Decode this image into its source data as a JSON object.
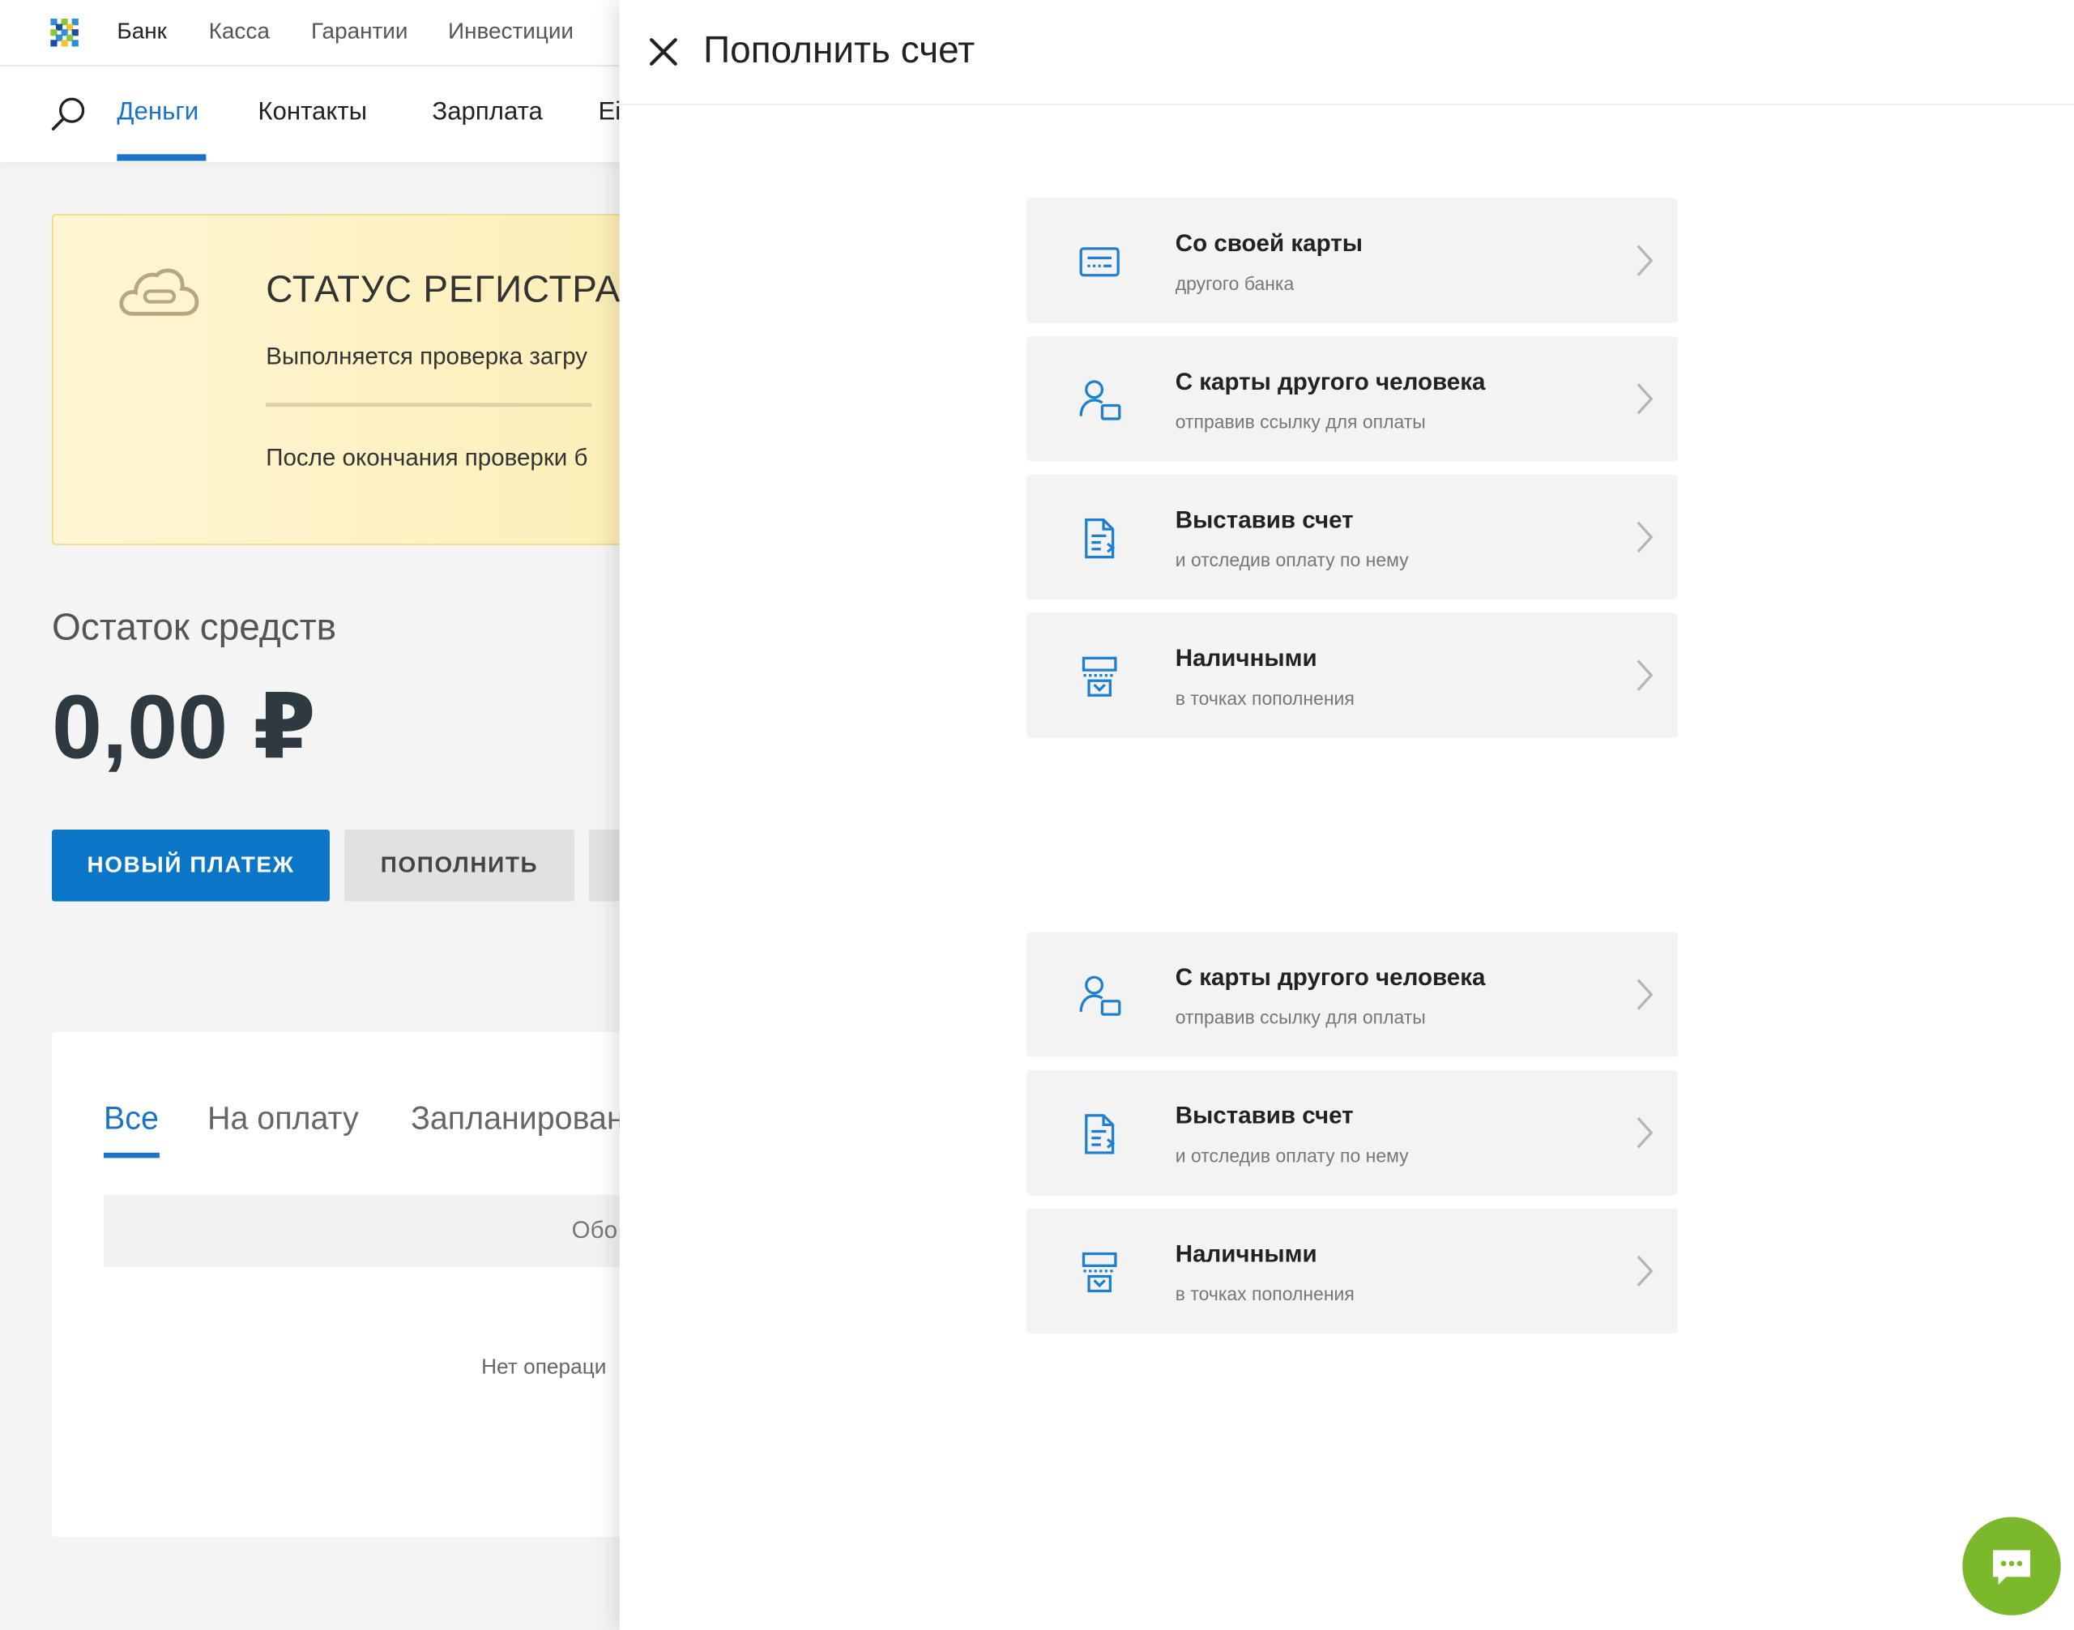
{
  "top_nav": {
    "items": [
      "Банк",
      "Касса",
      "Гарантии",
      "Инвестиции"
    ],
    "active": "Банк"
  },
  "sub_nav": {
    "items": [
      "Деньги",
      "Контакты",
      "Зарплата",
      "Ei"
    ],
    "active": "Деньги"
  },
  "registration_status": {
    "title": "СТАТУС РЕГИСТРАЦ",
    "checking_text": "Выполняется проверка загру",
    "after_text": "После окончания проверки б"
  },
  "balance": {
    "label": "Остаток средств",
    "value": "0,00 ₽"
  },
  "actions": {
    "new_payment": "НОВЫЙ ПЛАТЕЖ",
    "top_up": "ПОПОЛНИТЬ"
  },
  "operations": {
    "tabs": [
      "Все",
      "На оплату",
      "Запланирован"
    ],
    "active_tab": "Все",
    "turnover_label": "Обо",
    "empty_text": "Нет операци"
  },
  "panel": {
    "title": "Пополнить счет",
    "options_primary": [
      {
        "title": "Со своей карты",
        "subtitle": "другого банка",
        "icon": "card-icon"
      },
      {
        "title": "С карты другого человека",
        "subtitle": "отправив ссылку для оплаты",
        "icon": "person-card-icon"
      },
      {
        "title": "Выставив счет",
        "subtitle": "и отследив оплату по нему",
        "icon": "invoice-icon"
      },
      {
        "title": "Наличными",
        "subtitle": "в точках пополнения",
        "icon": "atm-icon"
      }
    ],
    "options_secondary": [
      {
        "title": "С карты другого человека",
        "subtitle": "отправив ссылку для оплаты",
        "icon": "person-card-icon"
      },
      {
        "title": "Выставив счет",
        "subtitle": "и отследив оплату по нему",
        "icon": "invoice-icon"
      },
      {
        "title": "Наличными",
        "subtitle": "в точках пополнения",
        "icon": "atm-icon"
      }
    ]
  },
  "colors": {
    "accent": "#0a76c5",
    "link_active": "#1a73c8",
    "chat_button": "#7cb82b",
    "status_card": "#fdefb8"
  },
  "icons": {
    "search": "search-icon",
    "close": "close-icon",
    "cloud": "cloud-icon",
    "chevron": "chevron-right-icon",
    "chat": "chat-icon"
  }
}
